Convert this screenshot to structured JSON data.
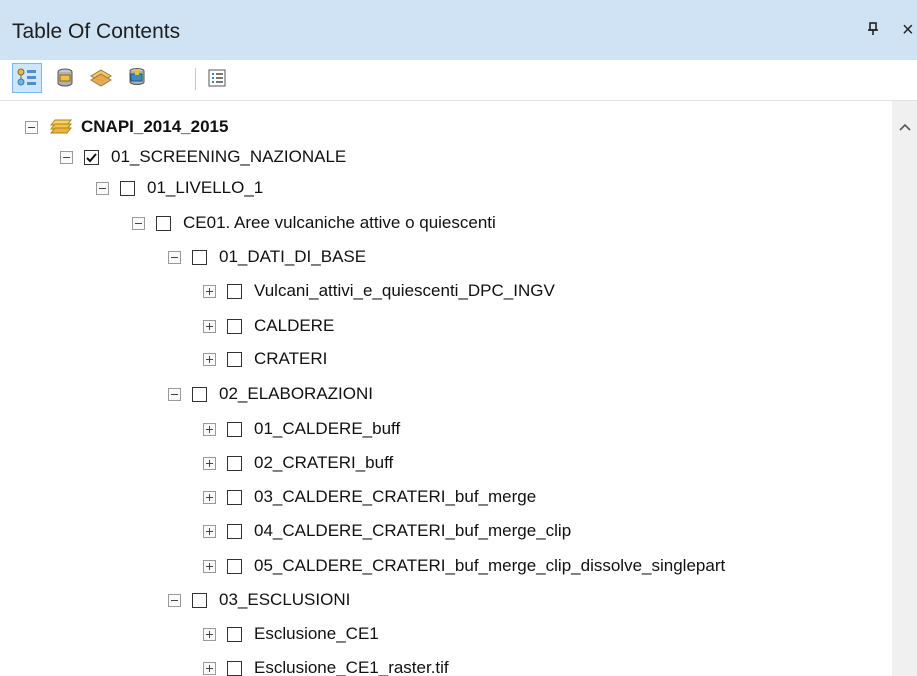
{
  "panel": {
    "title": "Table Of Contents",
    "pin_glyph": "ᵒ",
    "close_glyph": "×"
  },
  "toolbar": {
    "tools": [
      {
        "icon": "list-by-drawing-order-icon",
        "active": true
      },
      {
        "icon": "list-by-source-icon",
        "active": false
      },
      {
        "icon": "list-by-visibility-icon",
        "active": false
      },
      {
        "icon": "list-by-selection-icon",
        "active": false
      },
      {
        "icon": "options-icon",
        "active": false
      }
    ]
  },
  "tree": {
    "items": [
      {
        "label": "CNAPI_2014_2015",
        "level": 0,
        "expander": "minus",
        "type": "root"
      },
      {
        "label": "01_SCREENING_NAZIONALE",
        "level": 1,
        "expander": "minus",
        "checked": true
      },
      {
        "label": "01_LIVELLO_1",
        "level": 2,
        "expander": "minus",
        "checked": false
      },
      {
        "label": "CE01. Aree vulcaniche attive o quiescenti",
        "level": 3,
        "expander": "minus",
        "checked": false
      },
      {
        "label": "01_DATI_DI_BASE",
        "level": 4,
        "expander": "minus",
        "checked": false
      },
      {
        "label": "Vulcani_attivi_e_quiescenti_DPC_INGV",
        "level": 5,
        "expander": "plus",
        "checked": false
      },
      {
        "label": "CALDERE",
        "level": 5,
        "expander": "plus",
        "checked": false
      },
      {
        "label": "CRATERI",
        "level": 5,
        "expander": "plus",
        "checked": false
      },
      {
        "label": "02_ELABORAZIONI",
        "level": 4,
        "expander": "minus",
        "checked": false
      },
      {
        "label": "01_CALDERE_buff",
        "level": 5,
        "expander": "plus",
        "checked": false
      },
      {
        "label": "02_CRATERI_buff",
        "level": 5,
        "expander": "plus",
        "checked": false
      },
      {
        "label": "03_CALDERE_CRATERI_buf_merge",
        "level": 5,
        "expander": "plus",
        "checked": false
      },
      {
        "label": "04_CALDERE_CRATERI_buf_merge_clip",
        "level": 5,
        "expander": "plus",
        "checked": false
      },
      {
        "label": "05_CALDERE_CRATERI_buf_merge_clip_dissolve_singlepart",
        "level": 5,
        "expander": "plus",
        "checked": false
      },
      {
        "label": "03_ESCLUSIONI",
        "level": 4,
        "expander": "minus",
        "checked": false
      },
      {
        "label": "Esclusione_CE1",
        "level": 5,
        "expander": "plus",
        "checked": false
      },
      {
        "label": "Esclusione_CE1_raster.tif",
        "level": 5,
        "expander": "plus",
        "checked": false
      }
    ]
  }
}
